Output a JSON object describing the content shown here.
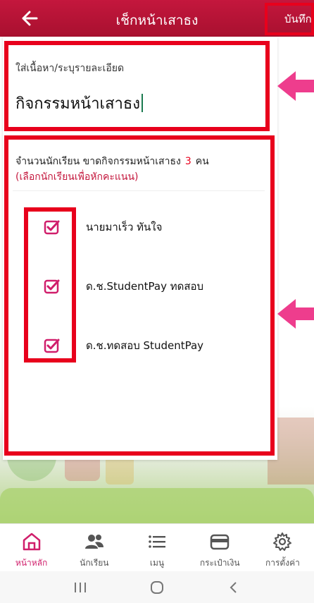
{
  "appbar": {
    "title": "เช็กหน้าเสาธง",
    "save_label": "บันทึก"
  },
  "detail": {
    "label": "ใส่เนื้อหา/ระบุรายละเอียด",
    "value": "กิจกรรมหน้าเสาธง"
  },
  "absence": {
    "prefix": "จำนวนนักเรียน ขาดกิจกรรมหน้าเสาธง",
    "count": "3",
    "unit": "คน",
    "hint": "(เลือกนักเรียนเพื่อหักคะแนน)"
  },
  "students": [
    {
      "name": "นายมาเร็ว ทันใจ",
      "checked": true
    },
    {
      "name": "ด.ช.StudentPay ทดสอบ",
      "checked": true
    },
    {
      "name": "ด.ช.ทดสอบ StudentPay",
      "checked": true
    }
  ],
  "nav": {
    "items": [
      {
        "label": "หน้าหลัก",
        "icon": "home-icon",
        "active": true
      },
      {
        "label": "นักเรียน",
        "icon": "users-icon",
        "active": false
      },
      {
        "label": "เมนู",
        "icon": "menu-icon",
        "active": false
      },
      {
        "label": "กระเป๋าเงิน",
        "icon": "wallet-icon",
        "active": false
      },
      {
        "label": "การตั้งค่า",
        "icon": "gear-icon",
        "active": false
      }
    ]
  },
  "colors": {
    "brand": "#c4173d",
    "highlight": "#e8001c",
    "accent": "#d01e6b",
    "arrow": "#ee3d8d"
  }
}
